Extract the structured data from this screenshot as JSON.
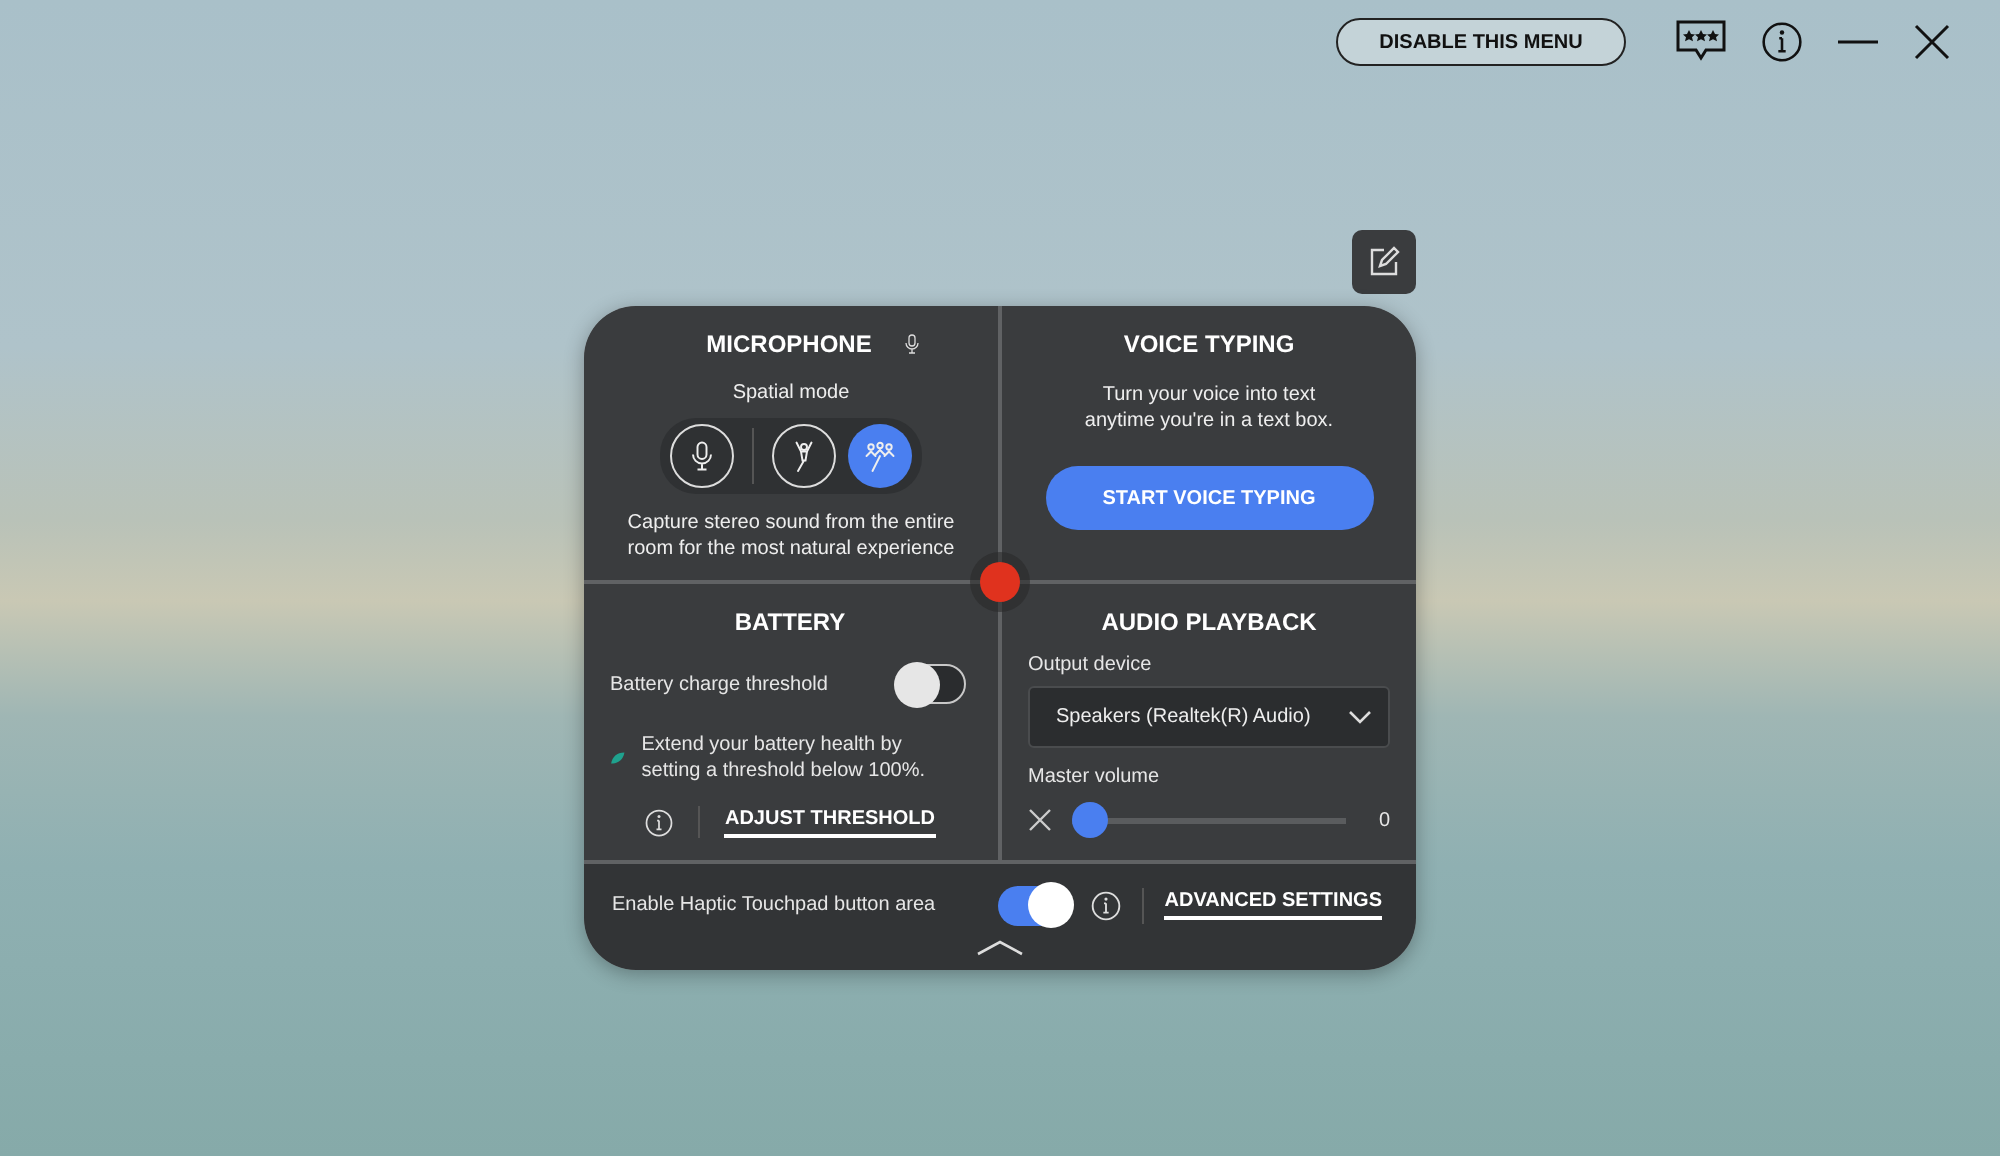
{
  "top_bar": {
    "disable_button": "DISABLE THIS MENU"
  },
  "microphone": {
    "title": "MICROPHONE",
    "subtitle": "Spatial mode",
    "modes": [
      {
        "kind": "standard",
        "selected": false
      },
      {
        "kind": "single",
        "selected": false
      },
      {
        "kind": "stereo",
        "selected": true
      }
    ],
    "description": "Capture stereo sound from the entire room for the most natural experience"
  },
  "voice_typing": {
    "title": "VOICE TYPING",
    "description": "Turn your voice into text anytime you're in a text box.",
    "button": "START VOICE TYPING"
  },
  "battery": {
    "title": "BATTERY",
    "threshold_label": "Battery charge threshold",
    "threshold_on": false,
    "note": "Extend your battery health by setting a threshold below 100%.",
    "link": "ADJUST THRESHOLD"
  },
  "audio_playback": {
    "title": "AUDIO PLAYBACK",
    "output_label": "Output device",
    "output_value": "Speakers (Realtek(R) Audio)",
    "volume_label": "Master volume",
    "volume": {
      "level": 0,
      "reading": "0"
    }
  },
  "haptic": {
    "label": "Enable Haptic Touchpad button area",
    "on": true,
    "link": "ADVANCED SETTINGS"
  }
}
